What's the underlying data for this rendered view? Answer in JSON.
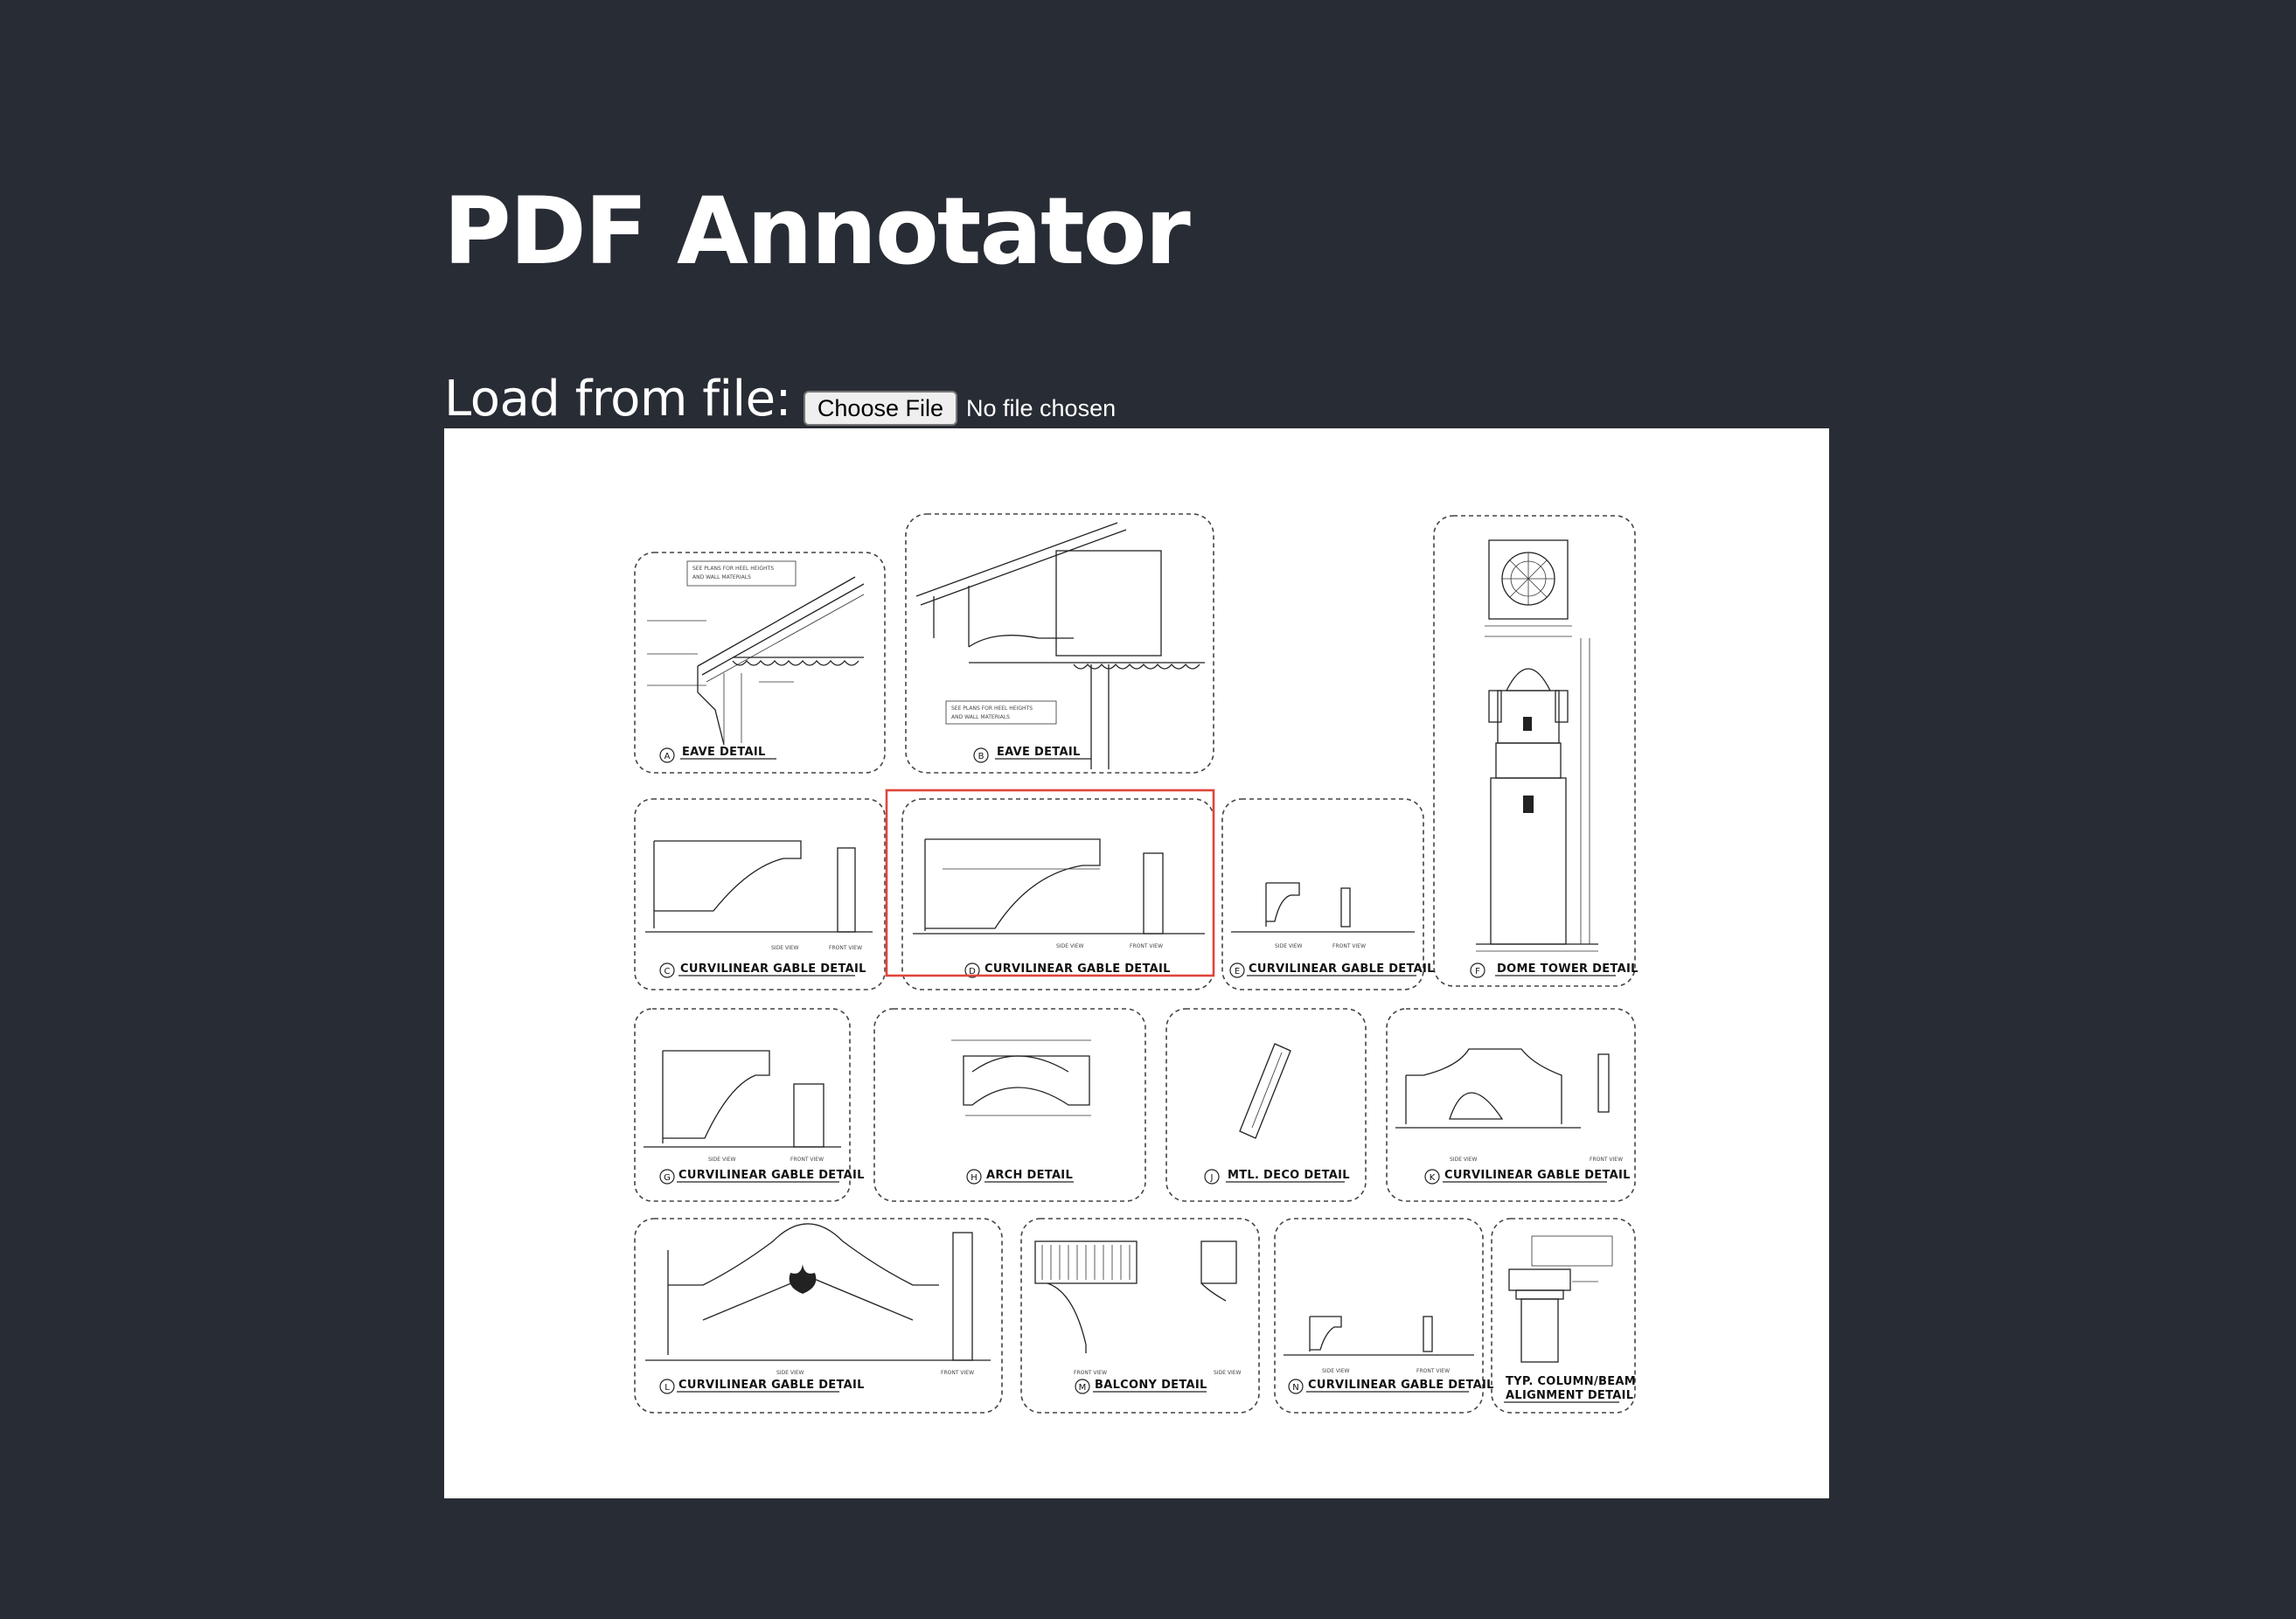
{
  "app": {
    "title": "PDF Annotator"
  },
  "loader": {
    "label": "Load from file:",
    "button_label": "Choose File",
    "status": "No file chosen"
  },
  "colors": {
    "background": "#282c34",
    "highlight": "#e0453a",
    "page": "#ffffff"
  },
  "drawing": {
    "details": [
      {
        "letter": "A",
        "title": "EAVE DETAIL"
      },
      {
        "letter": "B",
        "title": "EAVE DETAIL"
      },
      {
        "letter": "C",
        "title": "CURVILINEAR GABLE DETAIL"
      },
      {
        "letter": "D",
        "title": "CURVILINEAR GABLE DETAIL"
      },
      {
        "letter": "E",
        "title": "CURVILINEAR GABLE DETAIL"
      },
      {
        "letter": "F",
        "title": "DOME TOWER DETAIL"
      },
      {
        "letter": "G",
        "title": "CURVILINEAR GABLE DETAIL"
      },
      {
        "letter": "H",
        "title": "ARCH DETAIL"
      },
      {
        "letter": "J",
        "title": "MTL. DECO DETAIL"
      },
      {
        "letter": "K",
        "title": "CURVILINEAR GABLE DETAIL"
      },
      {
        "letter": "L",
        "title": "CURVILINEAR GABLE DETAIL"
      },
      {
        "letter": "M",
        "title": "BALCONY DETAIL"
      },
      {
        "letter": "N",
        "title": "CURVILINEAR GABLE DETAIL"
      },
      {
        "letter": "",
        "title": "TYP. COLUMN/BEAM",
        "title2": "ALIGNMENT DETAIL"
      }
    ],
    "notes": {
      "heel_note_1": "SEE PLANS FOR HEEL HEIGHTS",
      "heel_note_2": "AND WALL MATERIALS",
      "side_view": "SIDE VIEW",
      "front_view": "FRONT VIEW"
    },
    "highlighted_detail": "D"
  }
}
